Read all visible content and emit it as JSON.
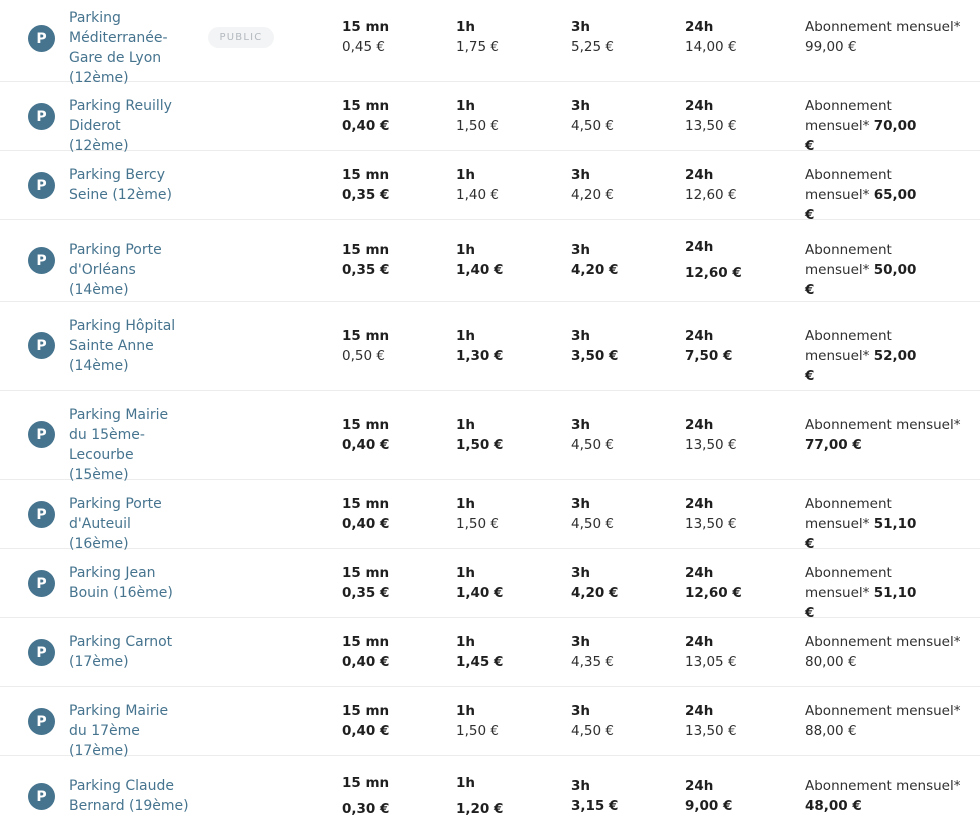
{
  "labels": {
    "m15": "15 mn",
    "h1": "1h",
    "h3": "3h",
    "h24": "24h"
  },
  "badge": "PUBLIC",
  "icon_letter": "P",
  "rows": [
    {
      "name": "Parking Méditerranée-Gare de Lyon (12ème)",
      "m15": "0,45 €",
      "h1": "1,75 €",
      "h3": "5,25 €",
      "h24": "14,00 €",
      "sub_label": "Abonnement mensuel*",
      "sub_price": "99,00 €"
    },
    {
      "name": "Parking Reuilly Diderot (12ème)",
      "m15": "0,40 €",
      "h1": "1,50 €",
      "h3": "4,50 €",
      "h24": "13,50 €",
      "sub_label": "Abonnement mensuel*",
      "sub_price": "70,00 €"
    },
    {
      "name": "Parking Bercy Seine (12ème)",
      "m15": "0,35 €",
      "h1": "1,40 €",
      "h3": "4,20 €",
      "h24": "12,60 €",
      "sub_label": "Abonnement mensuel*",
      "sub_price": "65,00 €"
    },
    {
      "name": "Parking Porte d'Orléans (14ème)",
      "m15": "0,35 €",
      "h1": "1,40 €",
      "h3": "4,20 €",
      "h24": "12,60 €",
      "sub_label": "Abonnement mensuel*",
      "sub_price": "50,00 €"
    },
    {
      "name": "Parking Hôpital Sainte Anne (14ème)",
      "m15": "0,50 €",
      "h1": "1,30 €",
      "h3": "3,50 €",
      "h24": "7,50 €",
      "sub_label": "Abonnement mensuel*",
      "sub_price": "52,00 €"
    },
    {
      "name": "Parking Mairie du 15ème-Lecourbe (15ème)",
      "m15": "0,40 €",
      "h1": "1,50 €",
      "h3": "4,50 €",
      "h24": "13,50 €",
      "sub_label": "Abonnement mensuel*",
      "sub_price": "77,00 €"
    },
    {
      "name": "Parking Porte d'Auteuil (16ème)",
      "m15": "0,40 €",
      "h1": "1,50 €",
      "h3": "4,50 €",
      "h24": "13,50 €",
      "sub_label": "Abonnement mensuel*",
      "sub_price": "51,10 €"
    },
    {
      "name": "Parking Jean Bouin (16ème)",
      "m15": "0,35 €",
      "h1": "1,40 €",
      "h3": "4,20 €",
      "h24": "12,60 €",
      "sub_label": "Abonnement mensuel*",
      "sub_price": "51,10 €"
    },
    {
      "name": "Parking Carnot (17ème)",
      "m15": "0,40 €",
      "h1": "1,45 €",
      "h3": "4,35 €",
      "h24": "13,05 €",
      "sub_label": "Abonnement mensuel*",
      "sub_price": "80,00 €"
    },
    {
      "name": "Parking Mairie du 17ème (17ème)",
      "m15": "0,40 €",
      "h1": "1,50 €",
      "h3": "4,50 €",
      "h24": "13,50 €",
      "sub_label": "Abonnement mensuel*",
      "sub_price": "88,00 €"
    },
    {
      "name": "Parking Claude Bernard (19ème)",
      "m15": "0,30 €",
      "h1": "1,20 €",
      "h3": "3,15 €",
      "h24": "9,00 €",
      "sub_label": "Abonnement mensuel*",
      "sub_price": "48,00 €"
    }
  ]
}
